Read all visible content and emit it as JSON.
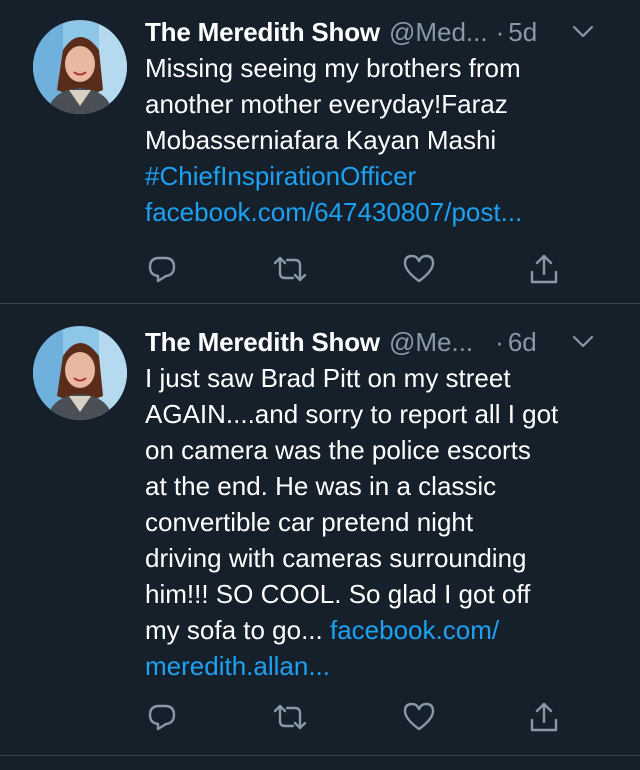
{
  "tweets": [
    {
      "display_name": "The Meredith Show",
      "handle": "@Med...",
      "dot": "·",
      "time": "5d",
      "text_lines": [
        "Missing seeing my brothers from",
        "another mother everyday!Faraz",
        "Mobasserniafara Kayan Mashi"
      ],
      "hashtag": "#ChiefInspirationOfficer",
      "link": "facebook.com/647430807/post...",
      "icons": {
        "reply": "reply-icon",
        "retweet": "retweet-icon",
        "like": "heart-icon",
        "share": "share-icon",
        "caret": "chevron-down-icon"
      }
    },
    {
      "display_name": "The Meredith Show",
      "handle": "@Me...",
      "dot": "·",
      "time": "6d",
      "text_lines": [
        "I just saw Brad Pitt on my street",
        "AGAIN....and sorry to report all I got",
        "on camera was the police escorts",
        "at the end. He was in a classic",
        "convertible car pretend night",
        "driving with cameras surrounding",
        "him!!! SO COOL. So glad I got off"
      ],
      "last_line_prefix": "my sofa to go... ",
      "link_part1": "facebook.com/",
      "link_part2": "meredith.allan...",
      "icons": {
        "reply": "reply-icon",
        "retweet": "retweet-icon",
        "like": "heart-icon",
        "share": "share-icon",
        "caret": "chevron-down-icon"
      }
    }
  ],
  "colors": {
    "background": "#15202b",
    "divider": "#38444d",
    "primary_text": "#ffffff",
    "secondary_text": "#8899a6",
    "link": "#1da1f2"
  }
}
